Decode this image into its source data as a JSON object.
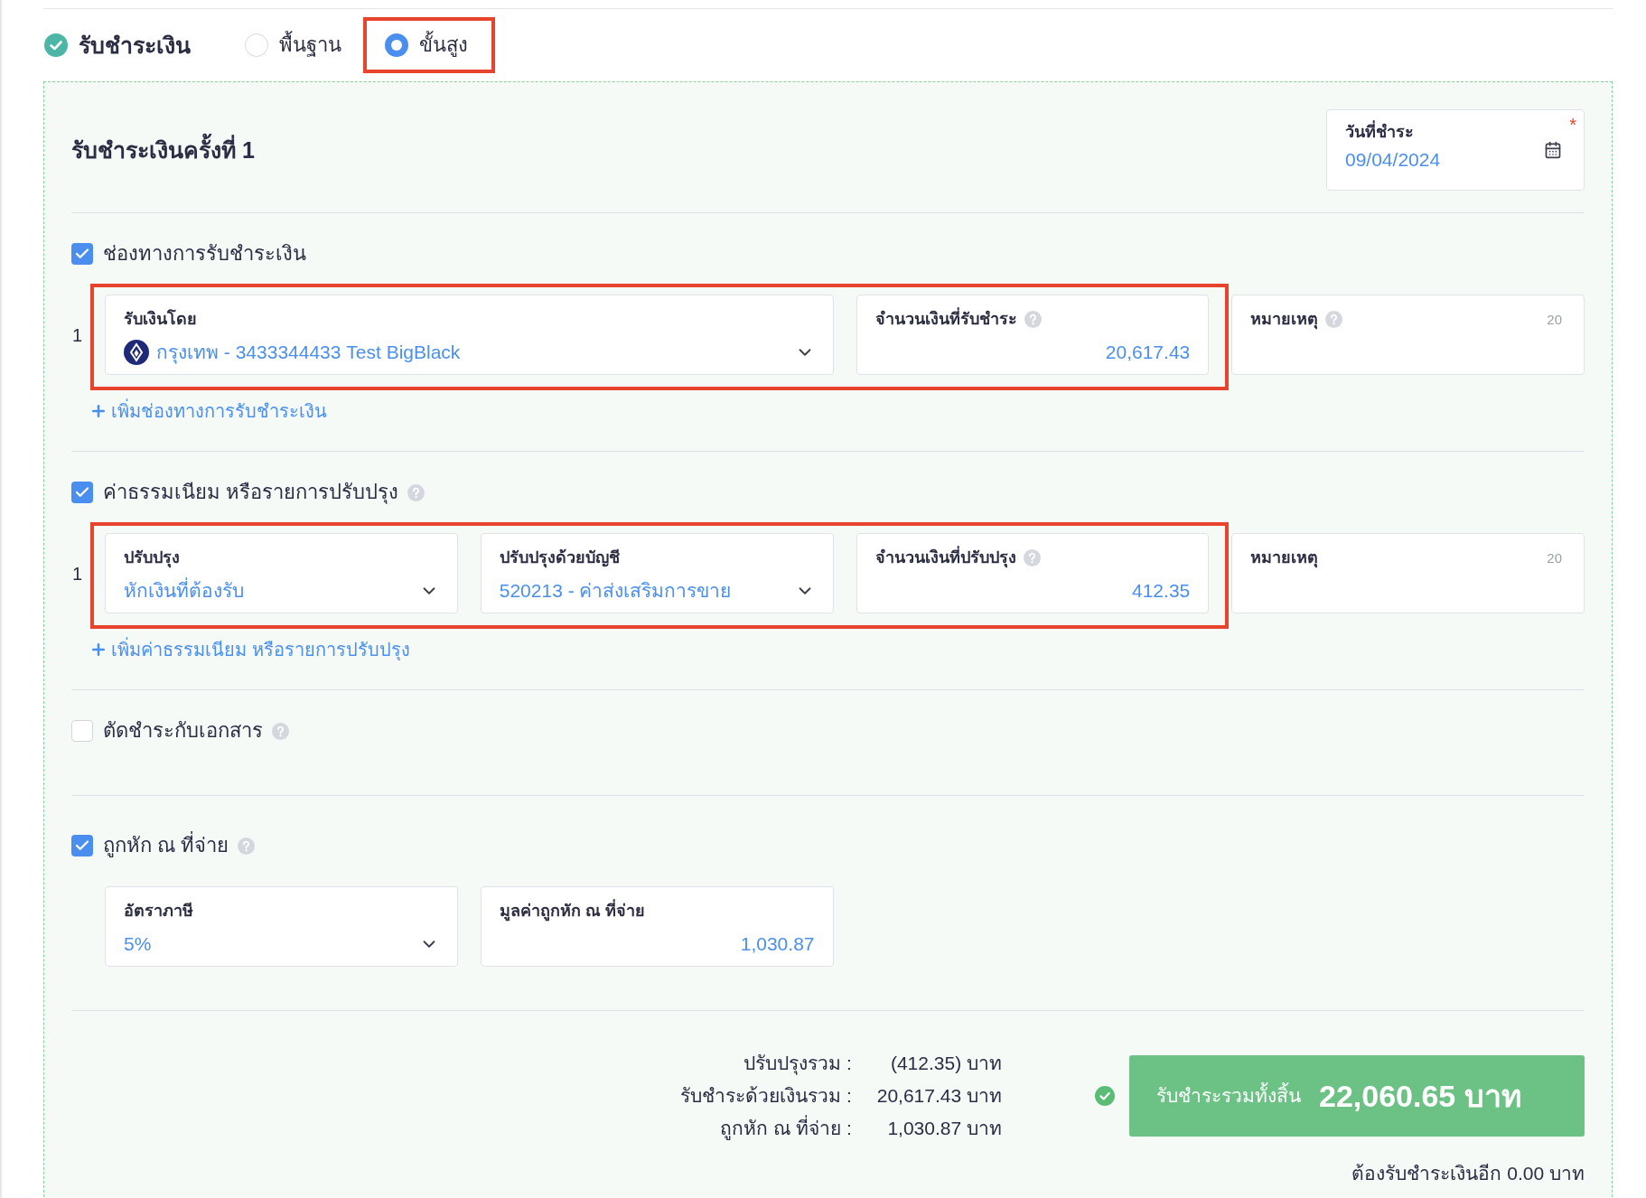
{
  "header": {
    "title": "รับชำระเงิน",
    "done": true,
    "modes": [
      {
        "label": "พื้นฐาน",
        "selected": false,
        "highlighted": false
      },
      {
        "label": "ขั้นสูง",
        "selected": true,
        "highlighted": true
      }
    ]
  },
  "payment": {
    "title": "รับชำระเงินครั้งที่ 1",
    "date": {
      "label": "วันที่ชำระ",
      "value": "09/04/2024",
      "required_mark": "*"
    }
  },
  "sections": [
    {
      "label": "ช่องทางการรับชำระเงิน",
      "checked": true,
      "help": false,
      "rows": [
        {
          "number": "1",
          "highlighted": true,
          "fields": [
            {
              "kind": "select",
              "label": "รับเงินโดย",
              "value": "กรุงเทพ - 3433344433 Test BigBlack",
              "bank_icon": true,
              "help": false
            },
            {
              "kind": "amount",
              "label": "จำนวนเงินที่รับชำระ",
              "value": "20,617.43",
              "help": true
            },
            {
              "kind": "note",
              "label": "หมายเหตุ",
              "counter": "20",
              "help": true
            }
          ]
        }
      ],
      "add_link": "เพิ่มช่องทางการรับชำระเงิน"
    },
    {
      "label": "ค่าธรรมเนียม หรือรายการปรับปรุง",
      "checked": true,
      "help": true,
      "rows": [
        {
          "number": "1",
          "highlighted": true,
          "fields": [
            {
              "kind": "select",
              "label": "ปรับปรุง",
              "value": "หักเงินที่ต้องรับ",
              "help": false
            },
            {
              "kind": "select",
              "label": "ปรับปรุงด้วยบัญชี",
              "value": "520213 - ค่าส่งเสริมการขาย",
              "help": false
            },
            {
              "kind": "amount",
              "label": "จำนวนเงินที่ปรับปรุง",
              "value": "412.35",
              "help": true
            },
            {
              "kind": "note",
              "label": "หมายเหตุ",
              "counter": "20",
              "help": false
            }
          ]
        }
      ],
      "add_link": "เพิ่มค่าธรรมเนียม หรือรายการปรับปรุง"
    },
    {
      "label": "ตัดชำระกับเอกสาร",
      "checked": false,
      "help": true
    },
    {
      "label": "ถูกหัก ณ ที่จ่าย",
      "checked": true,
      "help": true,
      "rows": [
        {
          "highlighted": false,
          "fields": [
            {
              "kind": "select",
              "label": "อัตราภาษี",
              "value": "5%",
              "help": false
            },
            {
              "kind": "amount",
              "label": "มูลค่าถูกหัก ณ ที่จ่าย",
              "value": "1,030.87",
              "help": false
            }
          ]
        }
      ]
    }
  ],
  "summary": {
    "lines": [
      {
        "label": "ปรับปรุงรวม :",
        "value": "(412.35) บาท"
      },
      {
        "label": "รับชำระด้วยเงินรวม :",
        "value": "20,617.43 บาท"
      },
      {
        "label": "ถูกหัก ณ ที่จ่าย :",
        "value": "1,030.87 บาท"
      }
    ],
    "total": {
      "label": "รับชำระรวมทั้งสิ้น",
      "value": "22,060.65 บาท",
      "ok": true
    },
    "remaining": "ต้องรับชำระเงินอีก 0.00 บาท"
  }
}
